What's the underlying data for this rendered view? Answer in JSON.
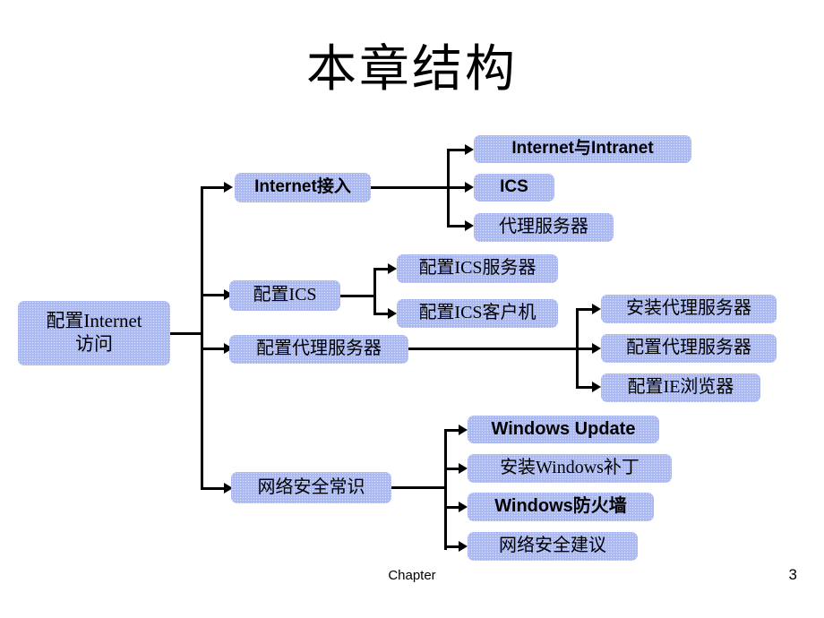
{
  "slide": {
    "title": "本章结构",
    "footer_label": "Chapter",
    "page_number": "3",
    "accent_color": "#aebcf2",
    "line_color": "#000000",
    "background_color": "#ffffff"
  },
  "diagram": {
    "type": "tree",
    "root": {
      "line1": "配置Internet",
      "line2": "访问"
    },
    "branches": [
      {
        "label": "Internet接入",
        "children": [
          {
            "label": "Internet与Intranet"
          },
          {
            "label": "ICS"
          },
          {
            "label": "代理服务器"
          }
        ]
      },
      {
        "label": "配置ICS",
        "children": [
          {
            "label": "配置ICS服务器"
          },
          {
            "label": "配置ICS客户机"
          }
        ]
      },
      {
        "label": "配置代理服务器",
        "children": [
          {
            "label": "安装代理服务器"
          },
          {
            "label": "配置代理服务器"
          },
          {
            "label": "配置IE浏览器"
          }
        ]
      },
      {
        "label": "网络安全常识",
        "children": [
          {
            "label": "Windows Update"
          },
          {
            "label": "安装Windows补丁"
          },
          {
            "label": "Windows防火墙"
          },
          {
            "label": "网络安全建议"
          }
        ]
      }
    ]
  }
}
